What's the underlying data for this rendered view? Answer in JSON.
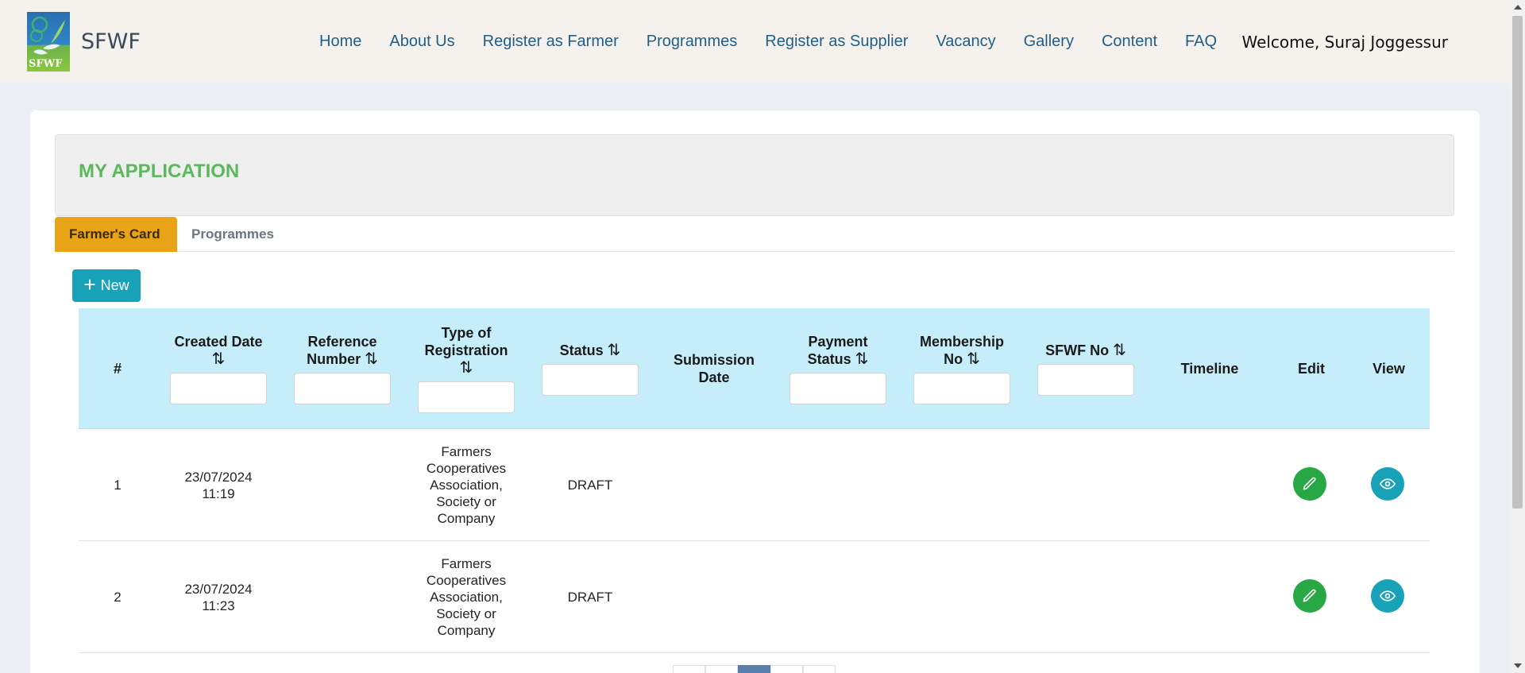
{
  "navbar": {
    "brand": "SFWF",
    "logo_text": "SFWF",
    "links": [
      "Home",
      "About Us",
      "Register as Farmer",
      "Programmes",
      "Register as Supplier",
      "Vacancy",
      "Gallery",
      "Content",
      "FAQ"
    ],
    "welcome": "Welcome, Suraj Joggessur"
  },
  "page": {
    "title": "MY APPLICATION"
  },
  "tabs": [
    "Farmer's Card",
    "Programmes"
  ],
  "new_button": "New",
  "table": {
    "sort_symbol": "⇅",
    "headers": [
      {
        "label": "#"
      },
      {
        "label": "Created Date",
        "sortable": true,
        "filter": true
      },
      {
        "label": "Reference Number",
        "sortable": true,
        "filter": true
      },
      {
        "label": "Type of Registration",
        "sortable": true,
        "filter": true
      },
      {
        "label": "Status",
        "sortable": true,
        "filter": true
      },
      {
        "label": "Submission Date"
      },
      {
        "label": "Payment Status",
        "sortable": true,
        "filter": true
      },
      {
        "label": "Membership No",
        "sortable": true,
        "filter": true
      },
      {
        "label": "SFWF No",
        "sortable": true,
        "filter": true
      },
      {
        "label": "Timeline"
      },
      {
        "label": "Edit"
      },
      {
        "label": "View"
      }
    ],
    "rows": [
      {
        "num": "1",
        "created_date": "23/07/2024",
        "created_time": "11:19",
        "type": "Farmers Cooperatives Association, Society or Company",
        "status": "DRAFT"
      },
      {
        "num": "2",
        "created_date": "23/07/2024",
        "created_time": "11:23",
        "type": "Farmers Cooperatives Association, Society or Company",
        "status": "DRAFT"
      }
    ]
  },
  "icons": {
    "edit": "pencil-icon",
    "view": "eye-icon",
    "add": "plus-icon"
  },
  "colors": {
    "nav_bg": "#f5f1ec",
    "nav_link": "#1f5f8b",
    "title_green": "#5cb85c",
    "tab_active": "#e8a416",
    "teal": "#17a2b8",
    "green": "#28a745",
    "table_header": "#c5eefa"
  }
}
